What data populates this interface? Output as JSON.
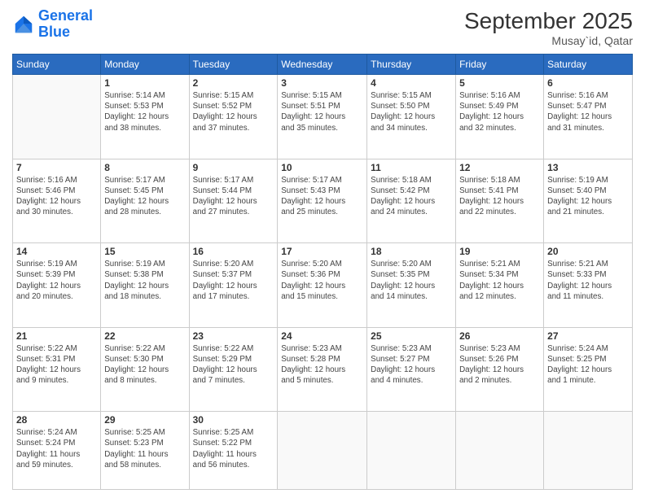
{
  "header": {
    "logo_general": "General",
    "logo_blue": "Blue",
    "month_title": "September 2025",
    "location": "Musay`id, Qatar"
  },
  "weekdays": [
    "Sunday",
    "Monday",
    "Tuesday",
    "Wednesday",
    "Thursday",
    "Friday",
    "Saturday"
  ],
  "weeks": [
    [
      {
        "day": "",
        "info": ""
      },
      {
        "day": "1",
        "info": "Sunrise: 5:14 AM\nSunset: 5:53 PM\nDaylight: 12 hours\nand 38 minutes."
      },
      {
        "day": "2",
        "info": "Sunrise: 5:15 AM\nSunset: 5:52 PM\nDaylight: 12 hours\nand 37 minutes."
      },
      {
        "day": "3",
        "info": "Sunrise: 5:15 AM\nSunset: 5:51 PM\nDaylight: 12 hours\nand 35 minutes."
      },
      {
        "day": "4",
        "info": "Sunrise: 5:15 AM\nSunset: 5:50 PM\nDaylight: 12 hours\nand 34 minutes."
      },
      {
        "day": "5",
        "info": "Sunrise: 5:16 AM\nSunset: 5:49 PM\nDaylight: 12 hours\nand 32 minutes."
      },
      {
        "day": "6",
        "info": "Sunrise: 5:16 AM\nSunset: 5:47 PM\nDaylight: 12 hours\nand 31 minutes."
      }
    ],
    [
      {
        "day": "7",
        "info": "Sunrise: 5:16 AM\nSunset: 5:46 PM\nDaylight: 12 hours\nand 30 minutes."
      },
      {
        "day": "8",
        "info": "Sunrise: 5:17 AM\nSunset: 5:45 PM\nDaylight: 12 hours\nand 28 minutes."
      },
      {
        "day": "9",
        "info": "Sunrise: 5:17 AM\nSunset: 5:44 PM\nDaylight: 12 hours\nand 27 minutes."
      },
      {
        "day": "10",
        "info": "Sunrise: 5:17 AM\nSunset: 5:43 PM\nDaylight: 12 hours\nand 25 minutes."
      },
      {
        "day": "11",
        "info": "Sunrise: 5:18 AM\nSunset: 5:42 PM\nDaylight: 12 hours\nand 24 minutes."
      },
      {
        "day": "12",
        "info": "Sunrise: 5:18 AM\nSunset: 5:41 PM\nDaylight: 12 hours\nand 22 minutes."
      },
      {
        "day": "13",
        "info": "Sunrise: 5:19 AM\nSunset: 5:40 PM\nDaylight: 12 hours\nand 21 minutes."
      }
    ],
    [
      {
        "day": "14",
        "info": "Sunrise: 5:19 AM\nSunset: 5:39 PM\nDaylight: 12 hours\nand 20 minutes."
      },
      {
        "day": "15",
        "info": "Sunrise: 5:19 AM\nSunset: 5:38 PM\nDaylight: 12 hours\nand 18 minutes."
      },
      {
        "day": "16",
        "info": "Sunrise: 5:20 AM\nSunset: 5:37 PM\nDaylight: 12 hours\nand 17 minutes."
      },
      {
        "day": "17",
        "info": "Sunrise: 5:20 AM\nSunset: 5:36 PM\nDaylight: 12 hours\nand 15 minutes."
      },
      {
        "day": "18",
        "info": "Sunrise: 5:20 AM\nSunset: 5:35 PM\nDaylight: 12 hours\nand 14 minutes."
      },
      {
        "day": "19",
        "info": "Sunrise: 5:21 AM\nSunset: 5:34 PM\nDaylight: 12 hours\nand 12 minutes."
      },
      {
        "day": "20",
        "info": "Sunrise: 5:21 AM\nSunset: 5:33 PM\nDaylight: 12 hours\nand 11 minutes."
      }
    ],
    [
      {
        "day": "21",
        "info": "Sunrise: 5:22 AM\nSunset: 5:31 PM\nDaylight: 12 hours\nand 9 minutes."
      },
      {
        "day": "22",
        "info": "Sunrise: 5:22 AM\nSunset: 5:30 PM\nDaylight: 12 hours\nand 8 minutes."
      },
      {
        "day": "23",
        "info": "Sunrise: 5:22 AM\nSunset: 5:29 PM\nDaylight: 12 hours\nand 7 minutes."
      },
      {
        "day": "24",
        "info": "Sunrise: 5:23 AM\nSunset: 5:28 PM\nDaylight: 12 hours\nand 5 minutes."
      },
      {
        "day": "25",
        "info": "Sunrise: 5:23 AM\nSunset: 5:27 PM\nDaylight: 12 hours\nand 4 minutes."
      },
      {
        "day": "26",
        "info": "Sunrise: 5:23 AM\nSunset: 5:26 PM\nDaylight: 12 hours\nand 2 minutes."
      },
      {
        "day": "27",
        "info": "Sunrise: 5:24 AM\nSunset: 5:25 PM\nDaylight: 12 hours\nand 1 minute."
      }
    ],
    [
      {
        "day": "28",
        "info": "Sunrise: 5:24 AM\nSunset: 5:24 PM\nDaylight: 11 hours\nand 59 minutes."
      },
      {
        "day": "29",
        "info": "Sunrise: 5:25 AM\nSunset: 5:23 PM\nDaylight: 11 hours\nand 58 minutes."
      },
      {
        "day": "30",
        "info": "Sunrise: 5:25 AM\nSunset: 5:22 PM\nDaylight: 11 hours\nand 56 minutes."
      },
      {
        "day": "",
        "info": ""
      },
      {
        "day": "",
        "info": ""
      },
      {
        "day": "",
        "info": ""
      },
      {
        "day": "",
        "info": ""
      }
    ]
  ]
}
